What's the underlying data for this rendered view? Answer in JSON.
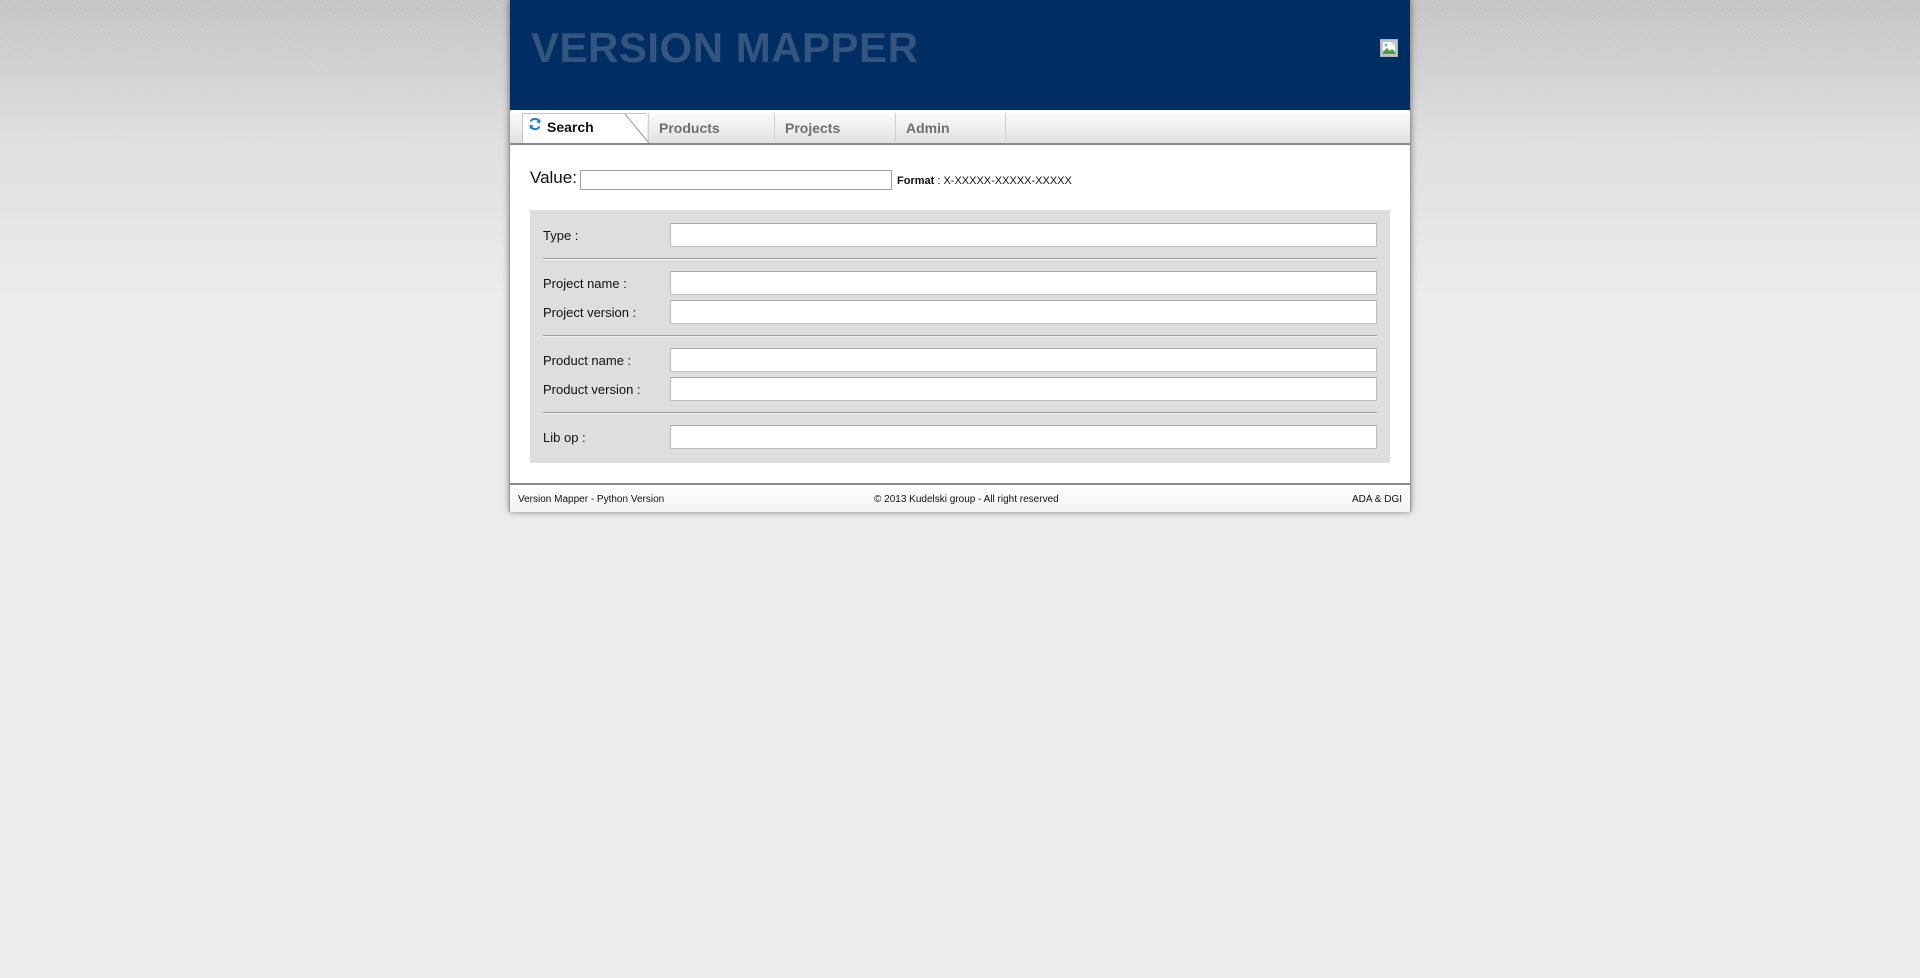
{
  "header": {
    "title": "VERSION MAPPER",
    "logo_icon": "broken-image-icon"
  },
  "tabs": [
    {
      "label": "Search",
      "icon": "refresh-icon",
      "active": true
    },
    {
      "label": "Products",
      "active": false
    },
    {
      "label": "Projects",
      "active": false
    },
    {
      "label": "Admin",
      "active": false
    }
  ],
  "search": {
    "value_label": "Value:",
    "value_input": "",
    "format_label": "Format",
    "format_value": ": X-XXXXX-XXXXX-XXXXX"
  },
  "fields": {
    "type": {
      "label": "Type :",
      "value": ""
    },
    "project_name": {
      "label": "Project name :",
      "value": ""
    },
    "project_version": {
      "label": "Project version :",
      "value": ""
    },
    "product_name": {
      "label": "Product name :",
      "value": ""
    },
    "product_version": {
      "label": "Product version :",
      "value": ""
    },
    "lib_op": {
      "label": "Lib op :",
      "value": ""
    }
  },
  "footer": {
    "left": "Version Mapper - Python Version",
    "center": "© 2013 Kudelski group - All right reserved",
    "right": "ADA & DGI"
  },
  "colors": {
    "header_bg": "#002e62",
    "title_color": "#33567f",
    "panel_bg": "#dedede",
    "page_bg": "#ececec",
    "tab_icon": "#1a7fc4"
  }
}
